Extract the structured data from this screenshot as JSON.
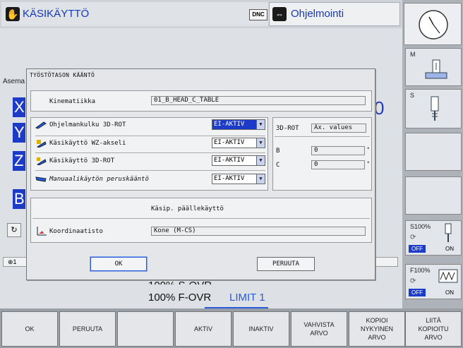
{
  "header": {
    "mode_left": "KÄSIKÄYTTÖ",
    "dnc_label": "DNC",
    "mode_right": "Ohjelmointi"
  },
  "main": {
    "asema_label": "Asema",
    "axes": [
      "X",
      "Y",
      "Z",
      "B"
    ],
    "axis_digit": "0",
    "status_number": "1",
    "s_ovr": "100% S-OVR",
    "f_ovr": "100% F-OVR",
    "limit": "LIMIT 1"
  },
  "right_softkeys": {
    "m_label": "M",
    "s_label": "S",
    "s100_label": "S100%",
    "f100_label": "F100%",
    "off": "OFF",
    "on": "ON"
  },
  "dialog": {
    "title": "TYÖSTÖTASON KÄÄNTÖ",
    "kinematics_label": "Kinematiikka",
    "kinematics_value": "01_B_HEAD_C_TABLE",
    "rows": [
      {
        "label": "Ohjelmankulku 3D-ROT",
        "value": "EI-AKTIV"
      },
      {
        "label": "Käsikäyttö WZ-akseli",
        "value": "EI-AKTIV"
      },
      {
        "label": "Käsikäyttö 3D-ROT",
        "value": "EI-AKTIV"
      },
      {
        "label": "Manuaalikäytön peruskääntö",
        "value": "EI-AKTIV"
      }
    ],
    "rot_label": "3D-ROT",
    "rot_value": "Ax. values",
    "b_label": "B",
    "b_value": "0",
    "b_unit": "°",
    "c_label": "C",
    "c_value": "0",
    "c_unit": "°",
    "overlay_title": "Käsip. päällekäyttö",
    "coord_label": "Koordinaatisto",
    "coord_value": "Kone (M-CS)",
    "ok_button": "OK",
    "cancel_button": "PERUUTA"
  },
  "bottom_softkeys": [
    "OK",
    "PERUUTA",
    "",
    "AKTIV",
    "INAKTIV",
    "VAHVISTA\nARVO",
    "KOPIOI\nNYKYINEN\nARVO",
    "LIITÄ\nKOPIOITU\nARVO"
  ],
  "colors": {
    "accent": "#1c3cc7",
    "limit": "#2a5bd8"
  }
}
